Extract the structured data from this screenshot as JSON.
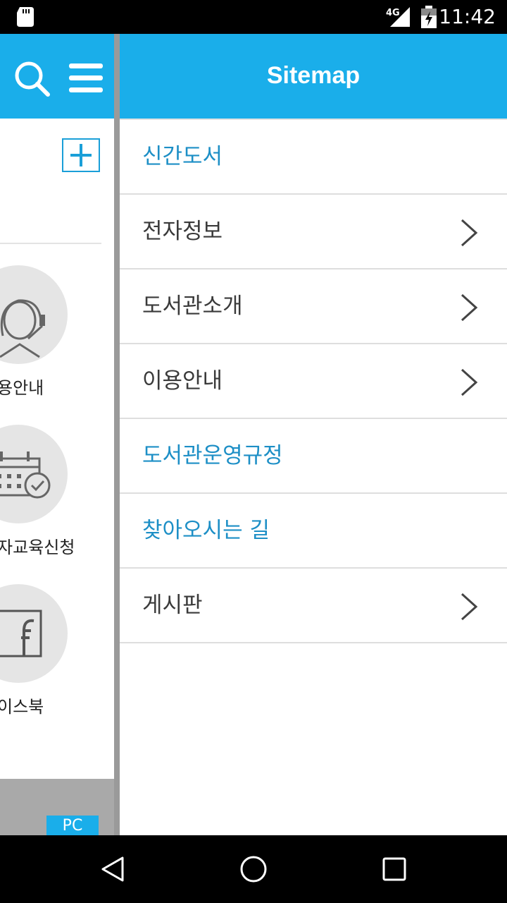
{
  "status_bar": {
    "time": "11:42",
    "network": "4G",
    "icons": [
      "sd-card-icon",
      "signal-icon",
      "battery-charging-icon"
    ]
  },
  "left_screen": {
    "items": [
      {
        "label": "용안내",
        "icon": "headset-agent-icon"
      },
      {
        "label": "자교육신청",
        "icon": "calendar-check-icon"
      },
      {
        "label": "이스북",
        "icon": "facebook-icon"
      }
    ],
    "footer_badge": "PC",
    "add_icon": "plus-icon"
  },
  "drawer": {
    "title": "Sitemap",
    "items": [
      {
        "label": "신간도서",
        "has_submenu": false
      },
      {
        "label": "전자정보",
        "has_submenu": true
      },
      {
        "label": "도서관소개",
        "has_submenu": true
      },
      {
        "label": "이용안내",
        "has_submenu": true
      },
      {
        "label": "도서관운영규정",
        "has_submenu": false
      },
      {
        "label": "찾아오시는 길",
        "has_submenu": false
      },
      {
        "label": "게시판",
        "has_submenu": true
      }
    ]
  },
  "colors": {
    "header": "#1aaeea",
    "link_text": "#1d8fc6",
    "text": "#3a3a3a"
  }
}
